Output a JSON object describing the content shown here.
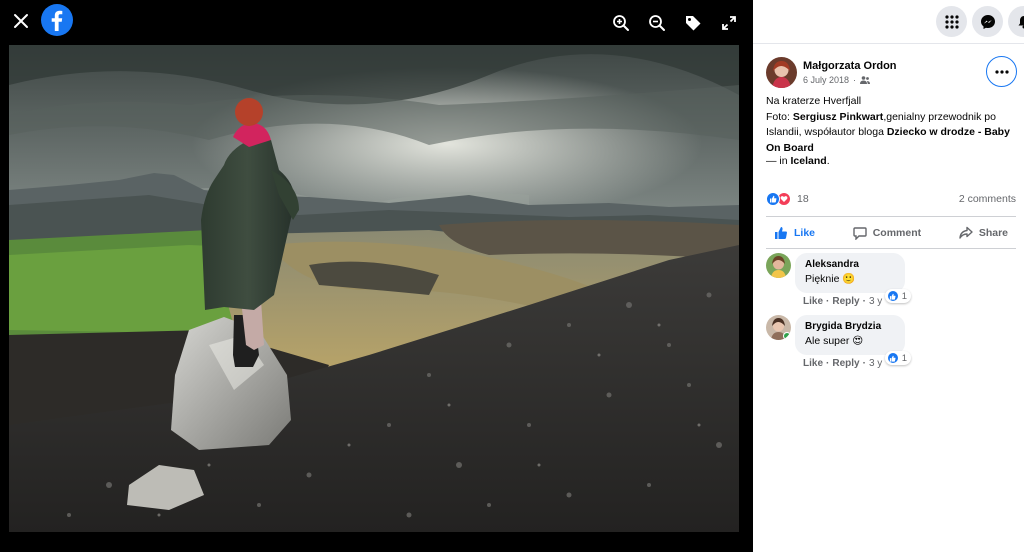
{
  "viewer": {
    "tools": [
      "zoom-in-icon",
      "zoom-out-icon",
      "tag-icon",
      "fullscreen-icon"
    ]
  },
  "header": {
    "buttons": [
      "menu-grid-icon",
      "messenger-icon",
      "notifications-icon"
    ]
  },
  "post": {
    "author": "Małgorzata Ordon",
    "date": "6 July 2018",
    "audience_icon": "friends-icon",
    "caption_line1": "Na kraterze Hverfjall",
    "caption_prefix": "Foto: ",
    "caption_tag1": "Sergiusz Pinkwart",
    "caption_mid": ",genialny przewodnik po Islandii, współautor bloga ",
    "caption_tag2": "Dziecko w drodze - Baby On Board",
    "checkin_prefix": "— in ",
    "checkin_place": "Iceland",
    "checkin_suffix": ".",
    "reaction_count": "18",
    "comments_count": "2 comments",
    "actions": {
      "like": "Like",
      "comment": "Comment",
      "share": "Share"
    }
  },
  "comments": [
    {
      "name": "Aleksandra",
      "text": "Pięknie 🙂",
      "react_count": "1",
      "like": "Like",
      "reply": "Reply",
      "age": "3 y"
    },
    {
      "name": "Brygida Brydzia",
      "text": "Ale super 😍",
      "react_count": "1",
      "like": "Like",
      "reply": "Reply",
      "age": "3 y"
    }
  ],
  "colors": {
    "brand": "#1877f2",
    "love": "#f33e58",
    "online": "#31a24c"
  }
}
